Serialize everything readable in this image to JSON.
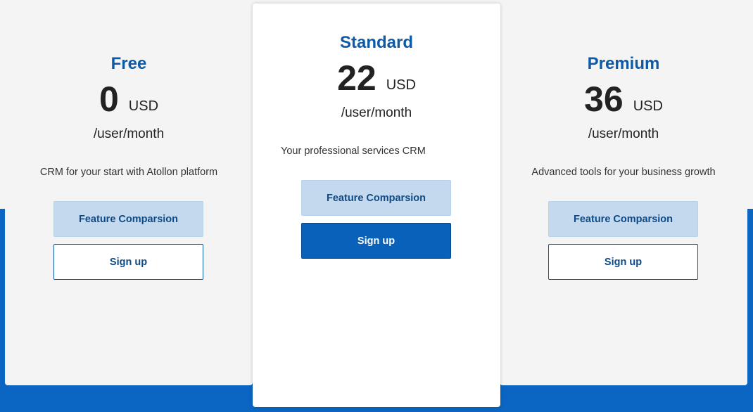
{
  "plans": [
    {
      "name": "Free",
      "price": "0",
      "currency": "USD",
      "period": "/user/month",
      "description": "CRM for your start with Atollon platform",
      "compare_label": "Feature Comparsion",
      "signup_label": "Sign up"
    },
    {
      "name": "Standard",
      "price": "22",
      "currency": "USD",
      "period": "/user/month",
      "description": "Your professional services CRM",
      "compare_label": "Feature Comparsion",
      "signup_label": "Sign up"
    },
    {
      "name": "Premium",
      "price": "36",
      "currency": "USD",
      "period": "/user/month",
      "description": "Advanced tools for your business growth",
      "compare_label": "Feature Comparsion",
      "signup_label": "Sign up"
    }
  ],
  "colors": {
    "accent": "#0a66c2",
    "plan_title": "#0d5aa7",
    "compare_button": "#c5d9ee",
    "card_background": "#f4f4f4",
    "featured_card_background": "#ffffff"
  }
}
